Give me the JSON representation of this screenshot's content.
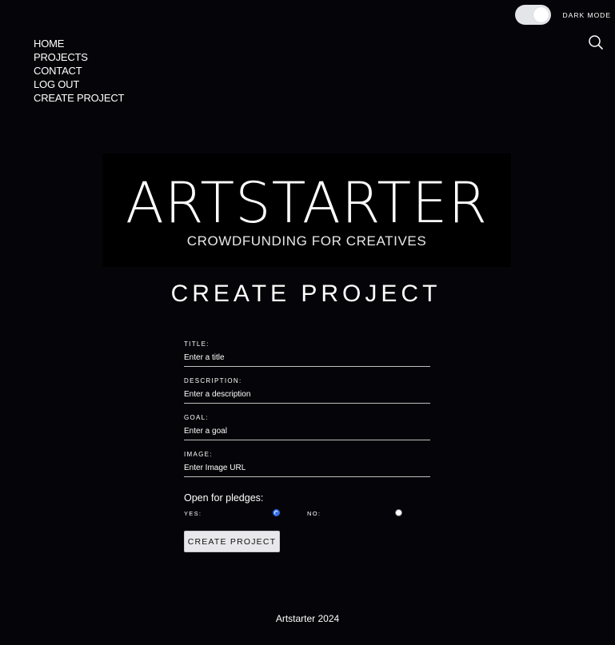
{
  "theme": {
    "background": "#050509",
    "text": "#ffffff",
    "accent": "#2f6ee8",
    "toggle_track": "#e4e5e9",
    "button_bg": "#e8e8ec"
  },
  "header": {
    "dark_mode_label": "DARK MODE",
    "dark_mode_on": true,
    "search_icon": "search-icon"
  },
  "nav": {
    "items": [
      {
        "label": "HOME"
      },
      {
        "label": "PROJECTS"
      },
      {
        "label": "CONTACT"
      },
      {
        "label": "LOG OUT"
      },
      {
        "label": "CREATE PROJECT"
      }
    ]
  },
  "logo": {
    "title": "ARTSTARTER",
    "tagline": "CROWDFUNDING FOR CREATIVES"
  },
  "main": {
    "title": "CREATE PROJECT"
  },
  "form": {
    "fields": [
      {
        "label": "TITLE:",
        "placeholder": "Enter a title",
        "value": ""
      },
      {
        "label": "DESCRIPTION:",
        "placeholder": "Enter a description",
        "value": ""
      },
      {
        "label": "GOAL:",
        "placeholder": "Enter a goal",
        "value": ""
      },
      {
        "label": "IMAGE:",
        "placeholder": "Enter Image URL",
        "value": ""
      }
    ],
    "pledge_heading": "Open for pledges:",
    "yes_label": "YES:",
    "no_label": "NO:",
    "selected": "yes",
    "submit_label": "CREATE PROJECT"
  },
  "footer": {
    "text": "Artstarter 2024"
  }
}
